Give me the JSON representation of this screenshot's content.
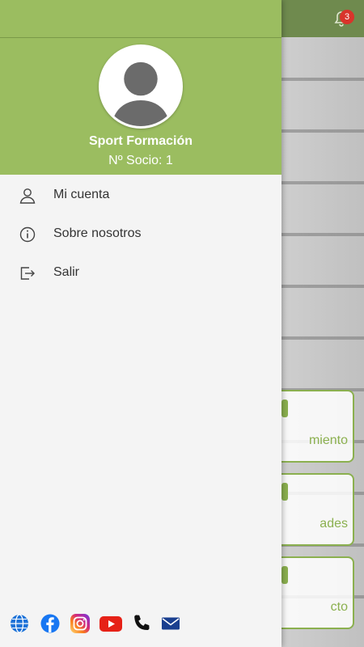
{
  "notifications": {
    "badge_count": "3"
  },
  "profile": {
    "name": "Sport Formación",
    "member_label": "Nº Socio: 1"
  },
  "menu": {
    "items": [
      {
        "label": "Mi cuenta",
        "icon": "user-icon"
      },
      {
        "label": "Sobre nosotros",
        "icon": "info-icon"
      },
      {
        "label": "Salir",
        "icon": "logout-icon"
      }
    ]
  },
  "background_cards": [
    {
      "label": "miento"
    },
    {
      "label": "ades"
    },
    {
      "label": "cto"
    }
  ],
  "social_links": [
    {
      "icon": "globe-icon"
    },
    {
      "icon": "facebook-icon"
    },
    {
      "icon": "instagram-icon"
    },
    {
      "icon": "youtube-icon"
    },
    {
      "icon": "phone-icon"
    },
    {
      "icon": "mail-icon"
    }
  ],
  "colors": {
    "header_green": "#9bbd60",
    "topbar_green": "#6f8a4e",
    "accent_green": "#8bb04f",
    "badge_red": "#d9342b",
    "drawer_bg": "#f4f4f4"
  }
}
